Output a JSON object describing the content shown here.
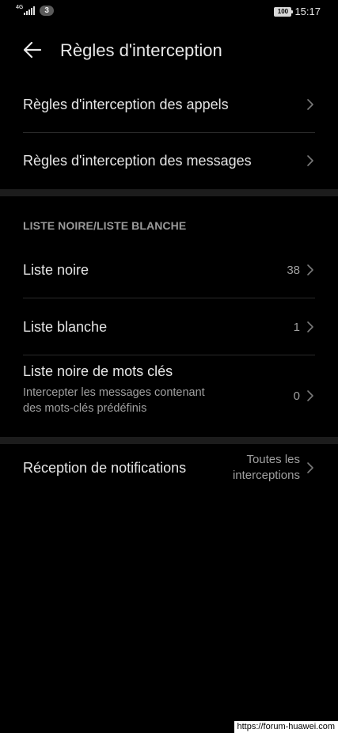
{
  "status_bar": {
    "network_label": "4G",
    "notification_count": "3",
    "battery_level": "100",
    "time": "15:17"
  },
  "header": {
    "title": "Règles d'interception"
  },
  "rules": {
    "calls_label": "Règles d'interception des appels",
    "messages_label": "Règles d'interception des messages"
  },
  "lists": {
    "section_header": "LISTE NOIRE/LISTE BLANCHE",
    "blacklist_label": "Liste noire",
    "blacklist_count": "38",
    "whitelist_label": "Liste blanche",
    "whitelist_count": "1",
    "keyword_label": "Liste noire de mots clés",
    "keyword_subtitle": "Intercepter les messages contenant des mots-clés prédéfinis",
    "keyword_count": "0"
  },
  "notifications": {
    "label": "Réception de notifications",
    "value": "Toutes les interceptions"
  },
  "watermark": "https://forum-huawei.com",
  "colors": {
    "background": "#000000",
    "text_primary": "#e6e6e6",
    "text_secondary": "#a0a0a0",
    "section_gap": "#1c1c1c",
    "divider": "#2a2a2a"
  }
}
